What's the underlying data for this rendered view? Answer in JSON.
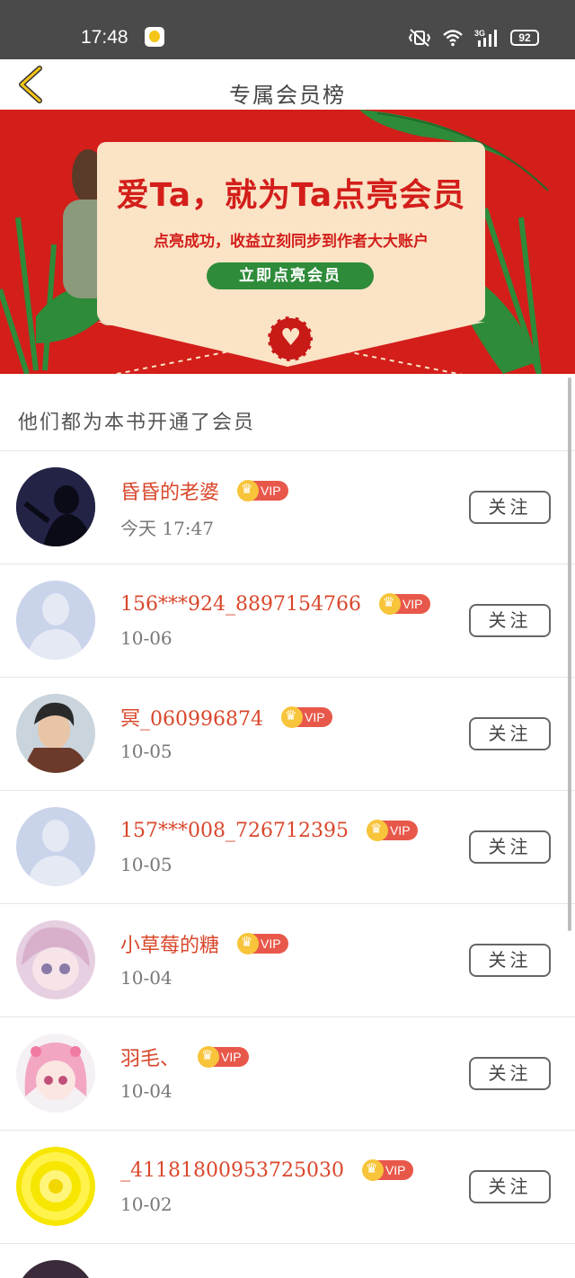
{
  "status_bar": {
    "time": "17:48",
    "battery": "92",
    "network": "3G"
  },
  "nav": {
    "title": "专属会员榜"
  },
  "banner": {
    "headline": "爱Ta，就为Ta点亮会员",
    "subtitle": "点亮成功，收益立刻同步到作者大大账户",
    "cta": "立即点亮会员"
  },
  "section": {
    "title": "他们都为本书开通了会员"
  },
  "members": [
    {
      "name": "昏昏的老婆",
      "badge": "VIP",
      "date": "今天  17:47",
      "follow": "关注"
    },
    {
      "name": "156***924_8897154766",
      "badge": "VIP",
      "date": "10-06",
      "follow": "关注"
    },
    {
      "name": "冥_060996874",
      "badge": "VIP",
      "date": "10-05",
      "follow": "关注"
    },
    {
      "name": "157***008_726712395",
      "badge": "VIP",
      "date": "10-05",
      "follow": "关注"
    },
    {
      "name": "小草莓的糖",
      "badge": "VIP",
      "date": "10-04",
      "follow": "关注"
    },
    {
      "name": "羽毛、",
      "badge": "VIP",
      "date": "10-04",
      "follow": "关注"
    },
    {
      "name": "_41181800953725030",
      "badge": "VIP",
      "date": "10-02",
      "follow": "关注"
    }
  ],
  "colors": {
    "accent": "#d9472b",
    "banner_red": "#d31e1a",
    "vip": "#e8584a",
    "crown": "#f7c43a",
    "cta_green": "#2e8b3a"
  }
}
